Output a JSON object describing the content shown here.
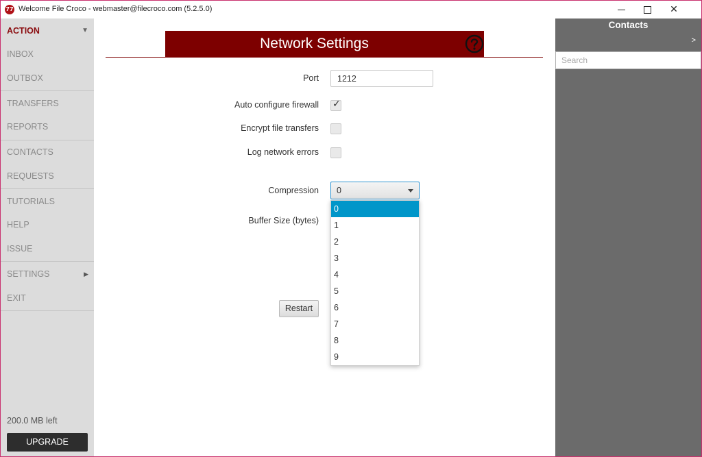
{
  "window": {
    "title": "Welcome  File Croco - webmaster@filecroco.com (5.2.5.0)",
    "app_icon_text": "77"
  },
  "sidebar": {
    "items": [
      {
        "label": "ACTION",
        "active": true
      },
      {
        "label": "INBOX"
      },
      {
        "label": "OUTBOX"
      },
      {
        "label": "TRANSFERS"
      },
      {
        "label": "REPORTS"
      },
      {
        "label": "CONTACTS"
      },
      {
        "label": "REQUESTS"
      },
      {
        "label": "TUTORIALS"
      },
      {
        "label": "HELP"
      },
      {
        "label": "ISSUE"
      },
      {
        "label": "SETTINGS"
      },
      {
        "label": "EXIT"
      }
    ],
    "storage_left": "200.0 MB left",
    "upgrade_label": "UPGRADE"
  },
  "main": {
    "title": "Network Settings",
    "port_label": "Port",
    "port_value": "1212",
    "auto_firewall_label": "Auto configure firewall",
    "auto_firewall_checked": true,
    "encrypt_label": "Encrypt file transfers",
    "encrypt_checked": false,
    "log_errors_label": "Log network errors",
    "log_errors_checked": false,
    "compression_label": "Compression",
    "compression_value": "0",
    "buffer_label": "Buffer Size (bytes)",
    "restart_label": "Restart",
    "compression_options": [
      "0",
      "1",
      "2",
      "3",
      "4",
      "5",
      "6",
      "7",
      "8",
      "9"
    ]
  },
  "contacts": {
    "title": "Contacts",
    "expand": ">",
    "search_placeholder": "Search"
  },
  "colors": {
    "brand": "#7d0000",
    "selection": "#0096c9",
    "sidebar": "#dcdcdc",
    "contacts_panel": "#6b6b6b"
  }
}
